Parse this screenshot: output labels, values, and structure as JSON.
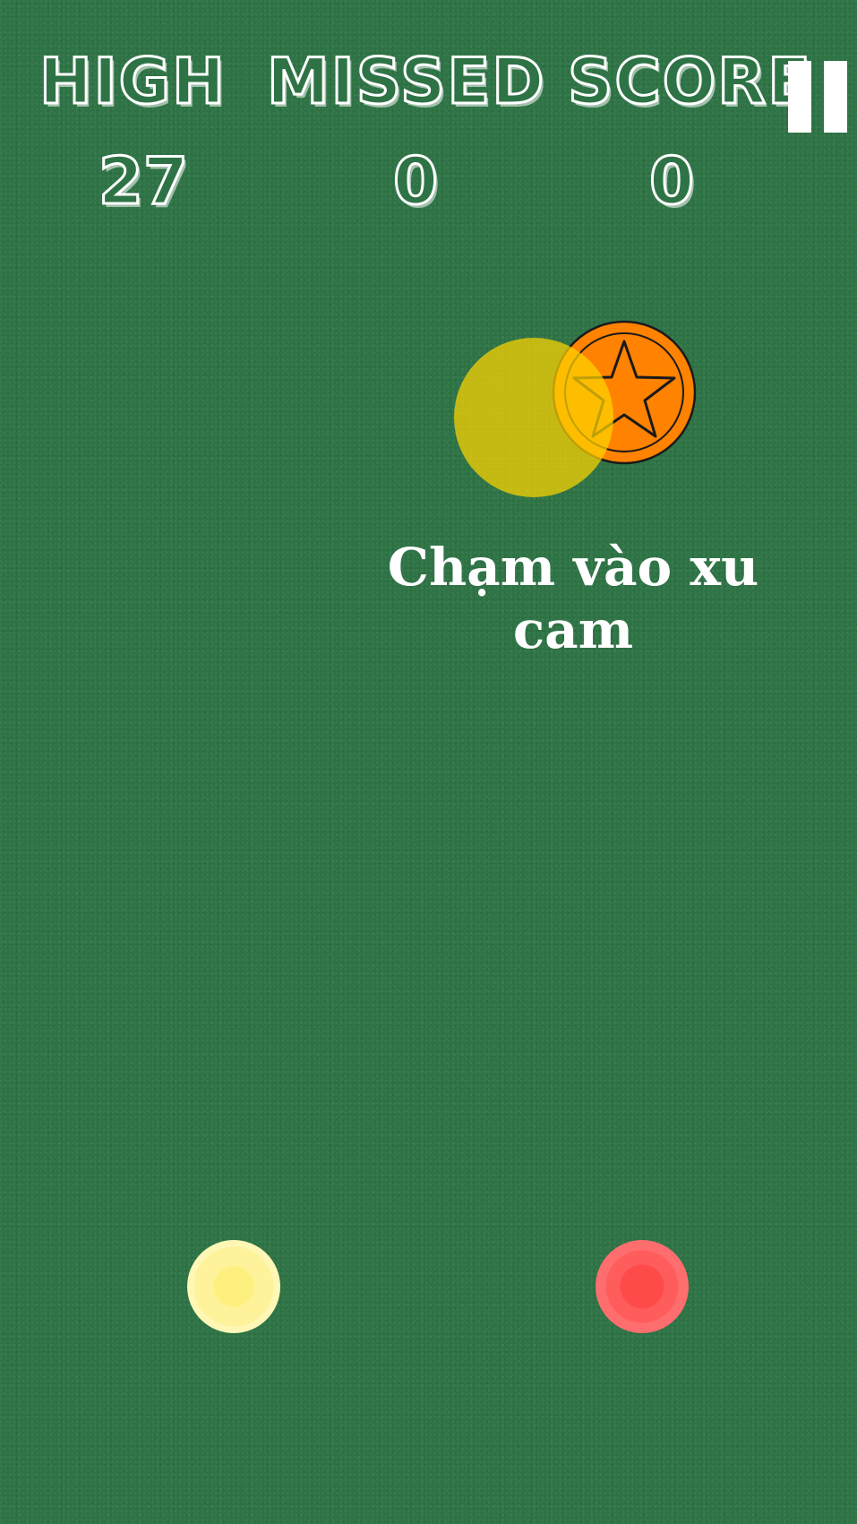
{
  "hud": {
    "high_label": "HIGH",
    "missed_label": "MISSED",
    "score_label": "SCORE",
    "high_value": "27",
    "missed_value": "0",
    "score_value": "0"
  },
  "hint": {
    "line1": "Chạm vào xu",
    "line2": "cam"
  },
  "icons": {
    "pause": "pause-icon",
    "coin": "orange-star-coin",
    "tap_target": "yellow-tap-circle",
    "yellow_button": "yellow-control-circle",
    "red_button": "red-control-circle"
  },
  "colors": {
    "background": "#2e7345",
    "coin_orange": "#ff8200",
    "tap_yellow": "#d6cc17",
    "control_yellow": "#fef29a",
    "control_red": "#ff5c5c"
  }
}
